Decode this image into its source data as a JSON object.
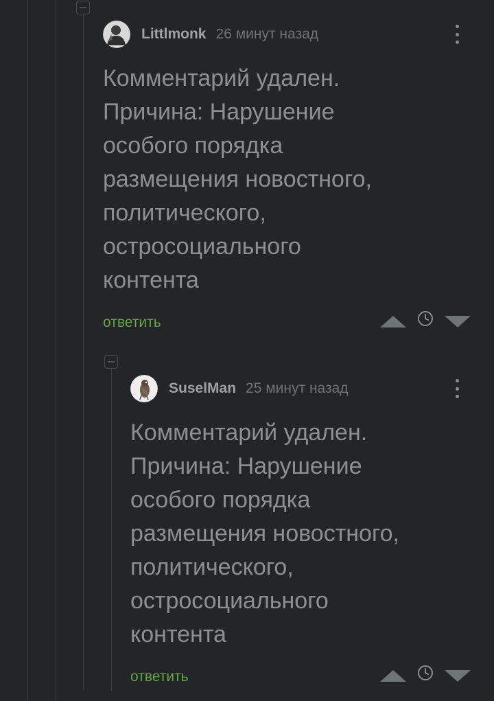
{
  "comments": [
    {
      "username": "Littlmonk",
      "time": "26 минут назад",
      "text": "Комментарий удален.\nПричина: Нарушение\nособого порядка\nразмещения новостного,\nполитического,\nостросоциального\nконтента",
      "reply_label": "ответить",
      "avatar_icon": "avatar-user-icon"
    },
    {
      "username": "SuselMan",
      "time": "25 минут назад",
      "text": "Комментарий удален.\nПричина: Нарушение\nособого порядка\nразмещения новостного,\nполитического,\nостросоциального\nконтента",
      "reply_label": "ответить",
      "avatar_icon": "avatar-bird-icon"
    }
  ],
  "colors": {
    "background": "#232528",
    "text": "#8c9093",
    "reply_link": "#63a53f",
    "thread_line": "#3a3d40"
  }
}
